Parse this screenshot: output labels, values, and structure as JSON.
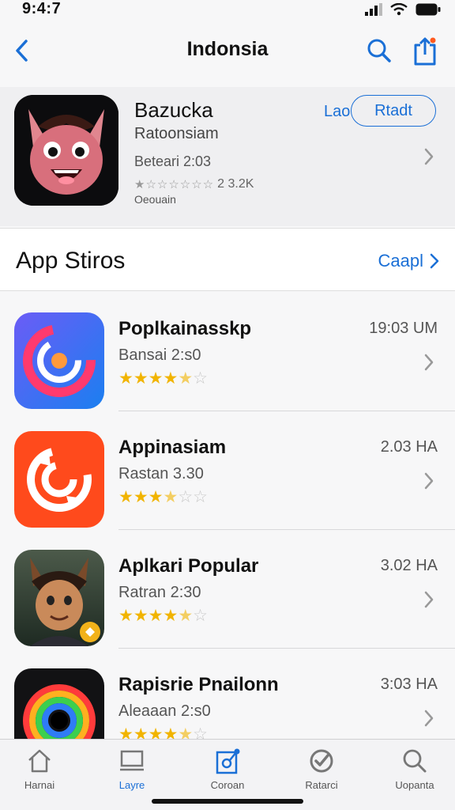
{
  "status_bar": {
    "time": "9:4:7"
  },
  "nav": {
    "title": "Indonsia"
  },
  "featured": {
    "title": "Bazucka",
    "subtitle": "Ratoonsiam",
    "meta": "Beteari 2:03",
    "rating_text": "2 3.2K",
    "caption": "Oeouain",
    "lao_label": "Lao",
    "action_label": "Rtadt"
  },
  "section": {
    "title": "App Stiros",
    "link_label": "Caapl"
  },
  "apps": [
    {
      "name": "Poplkainasskp",
      "sub": "Bansai 2:s0",
      "time": "19:03 UM",
      "rating": 4.5
    },
    {
      "name": "Appinasiam",
      "sub": "Rastan 3.30",
      "time": "2.03 HA",
      "rating": 3.5
    },
    {
      "name": "Aplkari Popular",
      "sub": "Ratran 2:30",
      "time": "3.02 HA",
      "rating": 4.5
    },
    {
      "name": "Rapisrie Pnailonn",
      "sub": "Aleaaan 2:s0",
      "time": "3:03 HA",
      "rating": 4.5
    }
  ],
  "tabs": [
    {
      "label": "Harnai",
      "icon": "home-icon",
      "active": false
    },
    {
      "label": "Layre",
      "icon": "layers-icon",
      "active": true
    },
    {
      "label": "Coroan",
      "icon": "clipboard-icon",
      "active": false
    },
    {
      "label": "Ratarci",
      "icon": "rating-icon",
      "active": false
    },
    {
      "label": "Uopanta",
      "icon": "search-icon",
      "active": false
    }
  ],
  "colors": {
    "accent": "#1a6fd6",
    "star": "#f1b400"
  }
}
